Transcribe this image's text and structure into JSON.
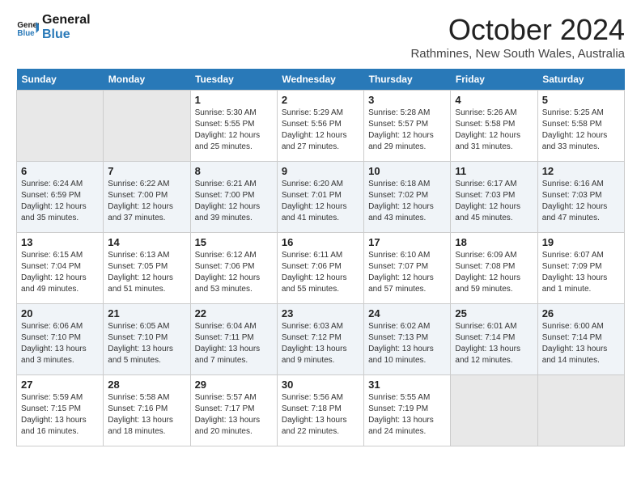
{
  "header": {
    "logo_line1": "General",
    "logo_line2": "Blue",
    "month": "October 2024",
    "location": "Rathmines, New South Wales, Australia"
  },
  "days_of_week": [
    "Sunday",
    "Monday",
    "Tuesday",
    "Wednesday",
    "Thursday",
    "Friday",
    "Saturday"
  ],
  "weeks": [
    [
      {
        "day": "",
        "empty": true
      },
      {
        "day": "",
        "empty": true
      },
      {
        "day": "1",
        "sunrise": "Sunrise: 5:30 AM",
        "sunset": "Sunset: 5:55 PM",
        "daylight": "Daylight: 12 hours and 25 minutes."
      },
      {
        "day": "2",
        "sunrise": "Sunrise: 5:29 AM",
        "sunset": "Sunset: 5:56 PM",
        "daylight": "Daylight: 12 hours and 27 minutes."
      },
      {
        "day": "3",
        "sunrise": "Sunrise: 5:28 AM",
        "sunset": "Sunset: 5:57 PM",
        "daylight": "Daylight: 12 hours and 29 minutes."
      },
      {
        "day": "4",
        "sunrise": "Sunrise: 5:26 AM",
        "sunset": "Sunset: 5:58 PM",
        "daylight": "Daylight: 12 hours and 31 minutes."
      },
      {
        "day": "5",
        "sunrise": "Sunrise: 5:25 AM",
        "sunset": "Sunset: 5:58 PM",
        "daylight": "Daylight: 12 hours and 33 minutes."
      }
    ],
    [
      {
        "day": "6",
        "sunrise": "Sunrise: 6:24 AM",
        "sunset": "Sunset: 6:59 PM",
        "daylight": "Daylight: 12 hours and 35 minutes."
      },
      {
        "day": "7",
        "sunrise": "Sunrise: 6:22 AM",
        "sunset": "Sunset: 7:00 PM",
        "daylight": "Daylight: 12 hours and 37 minutes."
      },
      {
        "day": "8",
        "sunrise": "Sunrise: 6:21 AM",
        "sunset": "Sunset: 7:00 PM",
        "daylight": "Daylight: 12 hours and 39 minutes."
      },
      {
        "day": "9",
        "sunrise": "Sunrise: 6:20 AM",
        "sunset": "Sunset: 7:01 PM",
        "daylight": "Daylight: 12 hours and 41 minutes."
      },
      {
        "day": "10",
        "sunrise": "Sunrise: 6:18 AM",
        "sunset": "Sunset: 7:02 PM",
        "daylight": "Daylight: 12 hours and 43 minutes."
      },
      {
        "day": "11",
        "sunrise": "Sunrise: 6:17 AM",
        "sunset": "Sunset: 7:03 PM",
        "daylight": "Daylight: 12 hours and 45 minutes."
      },
      {
        "day": "12",
        "sunrise": "Sunrise: 6:16 AM",
        "sunset": "Sunset: 7:03 PM",
        "daylight": "Daylight: 12 hours and 47 minutes."
      }
    ],
    [
      {
        "day": "13",
        "sunrise": "Sunrise: 6:15 AM",
        "sunset": "Sunset: 7:04 PM",
        "daylight": "Daylight: 12 hours and 49 minutes."
      },
      {
        "day": "14",
        "sunrise": "Sunrise: 6:13 AM",
        "sunset": "Sunset: 7:05 PM",
        "daylight": "Daylight: 12 hours and 51 minutes."
      },
      {
        "day": "15",
        "sunrise": "Sunrise: 6:12 AM",
        "sunset": "Sunset: 7:06 PM",
        "daylight": "Daylight: 12 hours and 53 minutes."
      },
      {
        "day": "16",
        "sunrise": "Sunrise: 6:11 AM",
        "sunset": "Sunset: 7:06 PM",
        "daylight": "Daylight: 12 hours and 55 minutes."
      },
      {
        "day": "17",
        "sunrise": "Sunrise: 6:10 AM",
        "sunset": "Sunset: 7:07 PM",
        "daylight": "Daylight: 12 hours and 57 minutes."
      },
      {
        "day": "18",
        "sunrise": "Sunrise: 6:09 AM",
        "sunset": "Sunset: 7:08 PM",
        "daylight": "Daylight: 12 hours and 59 minutes."
      },
      {
        "day": "19",
        "sunrise": "Sunrise: 6:07 AM",
        "sunset": "Sunset: 7:09 PM",
        "daylight": "Daylight: 13 hours and 1 minute."
      }
    ],
    [
      {
        "day": "20",
        "sunrise": "Sunrise: 6:06 AM",
        "sunset": "Sunset: 7:10 PM",
        "daylight": "Daylight: 13 hours and 3 minutes."
      },
      {
        "day": "21",
        "sunrise": "Sunrise: 6:05 AM",
        "sunset": "Sunset: 7:10 PM",
        "daylight": "Daylight: 13 hours and 5 minutes."
      },
      {
        "day": "22",
        "sunrise": "Sunrise: 6:04 AM",
        "sunset": "Sunset: 7:11 PM",
        "daylight": "Daylight: 13 hours and 7 minutes."
      },
      {
        "day": "23",
        "sunrise": "Sunrise: 6:03 AM",
        "sunset": "Sunset: 7:12 PM",
        "daylight": "Daylight: 13 hours and 9 minutes."
      },
      {
        "day": "24",
        "sunrise": "Sunrise: 6:02 AM",
        "sunset": "Sunset: 7:13 PM",
        "daylight": "Daylight: 13 hours and 10 minutes."
      },
      {
        "day": "25",
        "sunrise": "Sunrise: 6:01 AM",
        "sunset": "Sunset: 7:14 PM",
        "daylight": "Daylight: 13 hours and 12 minutes."
      },
      {
        "day": "26",
        "sunrise": "Sunrise: 6:00 AM",
        "sunset": "Sunset: 7:14 PM",
        "daylight": "Daylight: 13 hours and 14 minutes."
      }
    ],
    [
      {
        "day": "27",
        "sunrise": "Sunrise: 5:59 AM",
        "sunset": "Sunset: 7:15 PM",
        "daylight": "Daylight: 13 hours and 16 minutes."
      },
      {
        "day": "28",
        "sunrise": "Sunrise: 5:58 AM",
        "sunset": "Sunset: 7:16 PM",
        "daylight": "Daylight: 13 hours and 18 minutes."
      },
      {
        "day": "29",
        "sunrise": "Sunrise: 5:57 AM",
        "sunset": "Sunset: 7:17 PM",
        "daylight": "Daylight: 13 hours and 20 minutes."
      },
      {
        "day": "30",
        "sunrise": "Sunrise: 5:56 AM",
        "sunset": "Sunset: 7:18 PM",
        "daylight": "Daylight: 13 hours and 22 minutes."
      },
      {
        "day": "31",
        "sunrise": "Sunrise: 5:55 AM",
        "sunset": "Sunset: 7:19 PM",
        "daylight": "Daylight: 13 hours and 24 minutes."
      },
      {
        "day": "",
        "empty": true
      },
      {
        "day": "",
        "empty": true
      }
    ]
  ]
}
